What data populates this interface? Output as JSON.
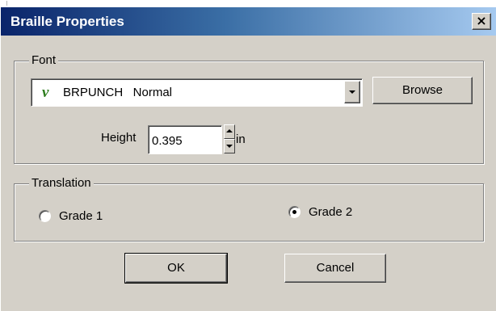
{
  "window": {
    "title": "Braille Properties",
    "close_label": "×"
  },
  "font_group": {
    "label": "Font",
    "font_select": {
      "glyph": "v",
      "value": "BRPUNCH   Normal"
    },
    "browse_label": "Browse",
    "height_label": "Height",
    "height_value": "0.395",
    "height_unit": "in"
  },
  "translation_group": {
    "label": "Translation",
    "options": [
      {
        "label": "Grade 1",
        "selected": false
      },
      {
        "label": "Grade 2",
        "selected": true
      }
    ]
  },
  "buttons": {
    "ok_label": "OK",
    "cancel_label": "Cancel"
  },
  "icons": {
    "font_type_icon": "truetype-v-glyph",
    "close_icon": "close-x-icon",
    "dropdown_icon": "triangle-down-icon",
    "spin_up_icon": "triangle-up-icon",
    "spin_down_icon": "triangle-down-icon"
  },
  "colors": {
    "titlebar_start": "#0a246a",
    "titlebar_end": "#a6caf0",
    "dialog_face": "#d4d0c8",
    "font_glyph": "#2e7d1e"
  }
}
